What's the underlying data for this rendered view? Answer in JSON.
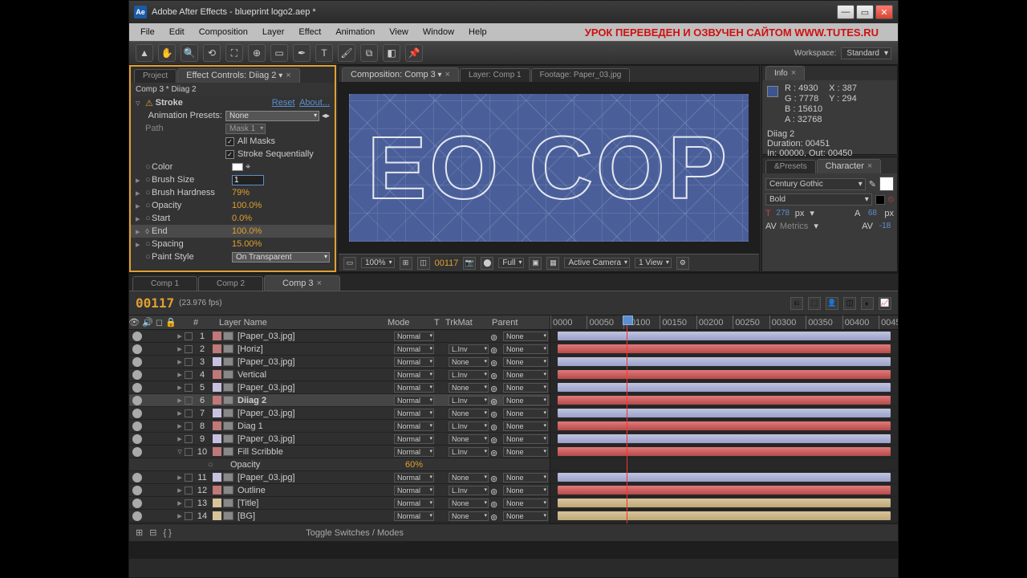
{
  "app": {
    "title": "Adobe After Effects - blueprint logo2.aep *",
    "icon": "Ae"
  },
  "menu": [
    "File",
    "Edit",
    "Composition",
    "Layer",
    "Effect",
    "Animation",
    "View",
    "Window",
    "Help"
  ],
  "watermark": "УРОК ПЕРЕВЕДЕН И ОЗВУЧЕН САЙТОМ WWW.TUTES.RU",
  "workspace": {
    "label": "Workspace:",
    "value": "Standard"
  },
  "panels": {
    "project_tab": "Project",
    "effect_tab": "Effect Controls: Diiag 2",
    "comp_label": "Comp 3 * Diiag 2"
  },
  "fx": {
    "name": "Stroke",
    "reset": "Reset",
    "about": "About...",
    "animPresetLabel": "Animation Presets:",
    "animPreset": "None",
    "pathLabel": "Path",
    "pathValue": "Mask 1",
    "allMasks": "All Masks",
    "strokeSeq": "Stroke Sequentially",
    "colorLabel": "Color",
    "brushSize": "Brush Size",
    "brushSizeVal": "1",
    "brushHard": "Brush Hardness",
    "brushHardVal": "79%",
    "opacity": "Opacity",
    "opacityVal": "100.0%",
    "start": "Start",
    "startVal": "0.0%",
    "end": "End",
    "endVal": "100.0%",
    "spacing": "Spacing",
    "spacingVal": "15.00%",
    "paintStyle": "Paint Style",
    "paintStyleVal": "On Transparent"
  },
  "viewer": {
    "tabs": [
      "Composition: Comp 3",
      "Layer: Comp 1",
      "Footage: Paper_03.jpg"
    ],
    "text": "EO COP",
    "zoom": "100%",
    "time": "00117",
    "res": "Full",
    "cam": "Active Camera",
    "views": "1 View"
  },
  "info": {
    "R": "4930",
    "G": "7778",
    "B": "15610",
    "A": "32768",
    "X": "387",
    "Y": "294",
    "layer": "Diiag 2",
    "dur": "Duration: 00451",
    "inout": "In: 00000, Out: 00450"
  },
  "char": {
    "presetsTab": "&Presets",
    "charTab": "Character",
    "font": "Century Gothic",
    "weight": "Bold",
    "size": "278",
    "unit": "px",
    "leading": "68",
    "tracking": "-18",
    "metrics": "Metrics"
  },
  "timeline": {
    "tabs": [
      "Comp 1",
      "Comp 2",
      "Comp 3"
    ],
    "timecode": "00117",
    "fps": "(23.976 fps)",
    "cols": {
      "name": "Layer Name",
      "mode": "Mode",
      "t": "T",
      "trk": "TrkMat",
      "parent": "Parent"
    },
    "ruler": [
      "0000",
      "00050",
      "00100",
      "00150",
      "00200",
      "00250",
      "00300",
      "00350",
      "00400",
      "0045"
    ],
    "opacityProp": "Opacity",
    "opacityVal": "60%",
    "footer": "Toggle Switches / Modes",
    "layers": [
      {
        "n": 1,
        "name": "[Paper_03.jpg]",
        "mode": "Normal",
        "trk": "",
        "lbl": "#c07878",
        "bar": "lav",
        "w": "96%"
      },
      {
        "n": 2,
        "name": "[Horiz]",
        "mode": "Normal",
        "trk": "L.Inv",
        "lbl": "#c07878",
        "bar": "red",
        "w": "96%"
      },
      {
        "n": 3,
        "name": "[Paper_03.jpg]",
        "mode": "Normal",
        "trk": "None",
        "lbl": "#c8c0e0",
        "bar": "lav",
        "w": "96%"
      },
      {
        "n": 4,
        "name": "Vertical",
        "mode": "Normal",
        "trk": "L.Inv",
        "lbl": "#c07878",
        "bar": "red",
        "w": "96%"
      },
      {
        "n": 5,
        "name": "[Paper_03.jpg]",
        "mode": "Normal",
        "trk": "None",
        "lbl": "#c8c0e0",
        "bar": "lav",
        "w": "96%"
      },
      {
        "n": 6,
        "name": "Diiag 2",
        "mode": "Normal",
        "trk": "L.Inv",
        "lbl": "#c07878",
        "bar": "red",
        "w": "96%",
        "sel": true,
        "bold": true
      },
      {
        "n": 7,
        "name": "[Paper_03.jpg]",
        "mode": "Normal",
        "trk": "None",
        "lbl": "#c8c0e0",
        "bar": "lav",
        "w": "96%"
      },
      {
        "n": 8,
        "name": "Diag 1",
        "mode": "Normal",
        "trk": "L.Inv",
        "lbl": "#c07878",
        "bar": "red",
        "w": "96%"
      },
      {
        "n": 9,
        "name": "[Paper_03.jpg]",
        "mode": "Normal",
        "trk": "None",
        "lbl": "#c8c0e0",
        "bar": "lav",
        "w": "96%"
      },
      {
        "n": 10,
        "name": "Fill Scribble",
        "mode": "Normal",
        "trk": "L.Inv",
        "lbl": "#c07878",
        "bar": "red",
        "w": "96%",
        "expand": true
      },
      {
        "prop": true
      },
      {
        "n": 11,
        "name": "[Paper_03.jpg]",
        "mode": "Normal",
        "trk": "None",
        "lbl": "#c8c0e0",
        "bar": "lav",
        "w": "96%"
      },
      {
        "n": 12,
        "name": "Outline",
        "mode": "Normal",
        "trk": "L.Inv",
        "lbl": "#c07878",
        "bar": "red",
        "w": "96%"
      },
      {
        "n": 13,
        "name": "[Title]",
        "mode": "Normal",
        "trk": "None",
        "lbl": "#d8c49a",
        "bar": "tan",
        "w": "96%"
      },
      {
        "n": 14,
        "name": "[BG]",
        "mode": "Normal",
        "trk": "None",
        "lbl": "#d8c49a",
        "bar": "tan",
        "w": "96%"
      }
    ]
  }
}
